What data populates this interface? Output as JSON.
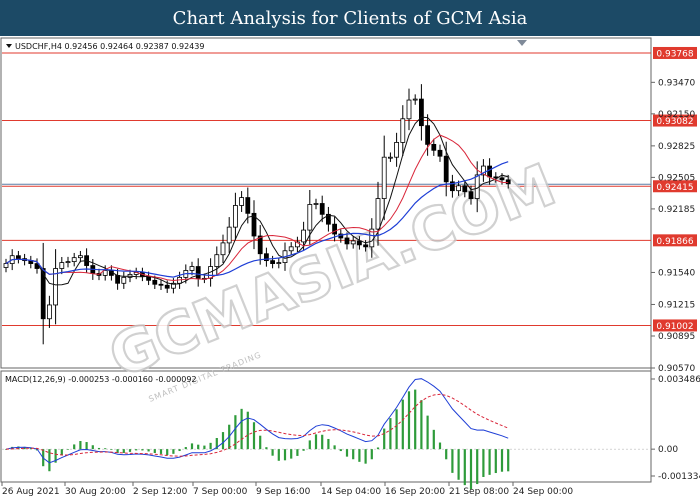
{
  "header": {
    "title": "Chart Analysis for Clients of GCM Asia"
  },
  "watermark": {
    "text": "GCMASIA.COM",
    "subtext": "SMART DIGITAL TRADING"
  },
  "chart_data": [
    {
      "type": "line",
      "subtype": "candlestick",
      "symbol_line": "USDCHF,H4  0.92456 0.92464 0.92387 0.92439",
      "ylim": [
        0.9057,
        0.9392
      ],
      "y_ticks": [
        "0.93470",
        "0.92150",
        "0.92825",
        "0.92505",
        "0.92185",
        "0.91540",
        "0.91215",
        "0.90895",
        "0.90570"
      ],
      "y_tick_values": [
        0.9347,
        0.9315,
        0.92825,
        0.92505,
        0.92185,
        0.9154,
        0.91215,
        0.90895,
        0.9057
      ],
      "x_ticks": [
        "26 Aug 2021",
        "30 Aug 20:00",
        "2 Sep 12:00",
        "7 Sep 00:00",
        "9 Sep 16:00",
        "14 Sep 04:00",
        "16 Sep 20:00",
        "21 Sep 08:00",
        "24 Sep 00:00"
      ],
      "levels": [
        {
          "value": 0.93768,
          "label": "0.93768"
        },
        {
          "value": 0.93082,
          "label": "0.93082"
        },
        {
          "value": 0.92415,
          "label": "0.92415"
        },
        {
          "value": 0.91866,
          "label": "0.91866"
        },
        {
          "value": 0.91002,
          "label": "0.91002"
        }
      ],
      "anchors": [
        0.9163,
        0.9171,
        0.9168,
        0.9166,
        0.9163,
        0.9158,
        0.9107,
        0.9121,
        0.9158,
        0.9164,
        0.9165,
        0.9169,
        0.9171,
        0.9161,
        0.9153,
        0.9151,
        0.9156,
        0.9151,
        0.9143,
        0.9149,
        0.9152,
        0.9154,
        0.915,
        0.9146,
        0.9142,
        0.9141,
        0.9138,
        0.9143,
        0.9149,
        0.9156,
        0.916,
        0.9148,
        0.9148,
        0.916,
        0.9172,
        0.9184,
        0.92,
        0.9222,
        0.923,
        0.9214,
        0.9191,
        0.9173,
        0.9166,
        0.9163,
        0.9164,
        0.9176,
        0.918,
        0.9185,
        0.9197,
        0.9223,
        0.9224,
        0.9213,
        0.9203,
        0.9193,
        0.9189,
        0.9183,
        0.9186,
        0.9182,
        0.918,
        0.9198,
        0.9229,
        0.9271,
        0.9271,
        0.9286,
        0.931,
        0.9329,
        0.933,
        0.9303,
        0.9284,
        0.9278,
        0.9272,
        0.9246,
        0.9237,
        0.9242,
        0.9236,
        0.9229,
        0.9253,
        0.9262,
        0.9251,
        0.925,
        0.9248,
        0.9244
      ]
    },
    {
      "type": "bar",
      "name": "MACD(12,26,9)",
      "params_line": "MACD(12,26,9) -0.000253 -0.000160 -0.000092",
      "ylim": [
        -0.001334,
        0.003486
      ],
      "y_ticks": [
        "0.003486",
        "0.00",
        "-0.001334"
      ],
      "y_tick_values": [
        0.003486,
        0.0,
        -0.001334
      ]
    }
  ]
}
